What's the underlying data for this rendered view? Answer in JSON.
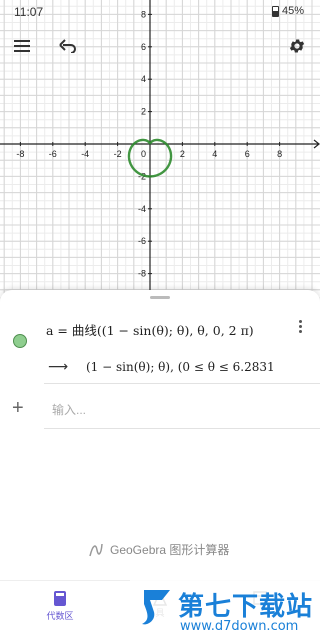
{
  "status_bar": {
    "time": "11:07",
    "battery": "45%"
  },
  "graph": {
    "x_ticks": [
      "-8",
      "-6",
      "-4",
      "-2",
      "2",
      "4",
      "6",
      "8"
    ],
    "y_ticks": [
      "8",
      "6",
      "4",
      "2",
      "-2",
      "-4",
      "-6",
      "-8"
    ],
    "origin_label": "0",
    "curve_color": "#2e8b2e",
    "grid_color": "#d6d6d6",
    "axis_color": "#222222"
  },
  "toolbar": {
    "menu_icon": "hamburger-icon",
    "undo_icon": "undo-icon",
    "settings_icon": "gear-icon"
  },
  "algebra": {
    "formula_input": "a = 曲线((1 − sin(θ);  θ), θ, 0, 2 π)",
    "arrow": "⟶",
    "formula_output": "(1 − sin(θ); θ),   (0 ≤ θ ≤ 6.28318",
    "new_input_placeholder": "输入...",
    "dot_color": "#8fce8f"
  },
  "brand": {
    "name": "GeoGebra 图形计算器"
  },
  "bottom_nav": {
    "algebra_label": "代数区",
    "tools_label": "具",
    "table_label": ""
  },
  "watermark": {
    "title": "第七下载站",
    "url": "www.d7down.com"
  }
}
